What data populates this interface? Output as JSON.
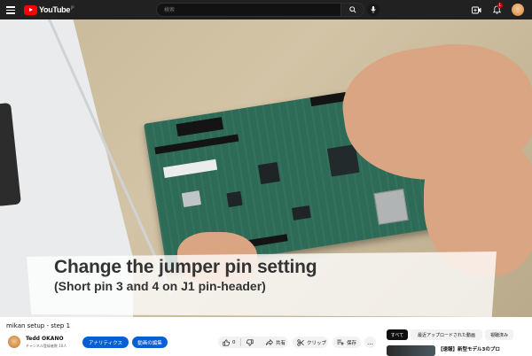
{
  "masthead": {
    "logo_text": "YouTube",
    "region": "JP",
    "search_placeholder": "検索",
    "notification_count": "1"
  },
  "player": {
    "caption_main": "Change the jumper pin setting",
    "caption_sub": "(Short pin 3 and 4 on J1 pin-header)"
  },
  "video": {
    "title": "mikan setup - step 1"
  },
  "owner": {
    "channel_name": "Tedd OKANO",
    "subscribers": "チャンネル登録者数 10人",
    "analytics_label": "アナリティクス",
    "edit_label": "動画の編集"
  },
  "actions": {
    "like_count": "0",
    "share_label": "共有",
    "clip_label": "クリップ",
    "save_label": "保存",
    "more_label": "…"
  },
  "chips": {
    "all": "すべて",
    "recent": "最近アップロードされた動画",
    "watched": "視聴済み"
  },
  "recommendation": {
    "title": "【速報】新型モデル3のプロ"
  },
  "icons": {
    "menu": "menu-icon",
    "search": "search-icon",
    "mic": "mic-icon",
    "create": "create-icon",
    "bell": "bell-icon",
    "like": "thumbs-up-icon",
    "dislike": "thumbs-down-icon",
    "share": "share-icon",
    "clip": "scissors-icon",
    "save": "playlist-add-icon"
  },
  "colors": {
    "masthead_bg": "#212121",
    "logo_red": "#ff0000",
    "accent_blue": "#065fd4",
    "chip_active": "#0f0f0f",
    "chip_bg": "#f2f2f2"
  }
}
